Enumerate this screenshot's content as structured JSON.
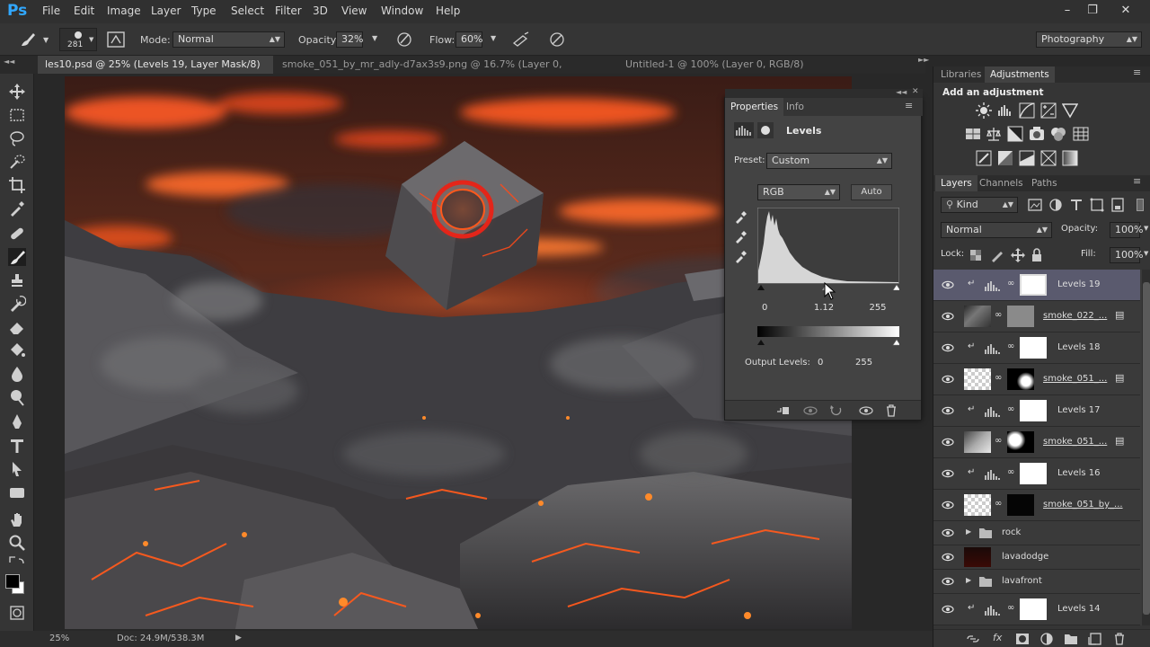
{
  "app": {
    "logo": "Ps"
  },
  "menu": [
    "File",
    "Edit",
    "Image",
    "Layer",
    "Type",
    "Select",
    "Filter",
    "3D",
    "View",
    "Window",
    "Help"
  ],
  "options": {
    "brush_size": "281",
    "mode_label": "Mode:",
    "mode_value": "Normal",
    "opacity_label": "Opacity:",
    "opacity_value": "32%",
    "flow_label": "Flow:",
    "flow_value": "60%",
    "workspace": "Photography"
  },
  "tabs": [
    {
      "label": "les10.psd @ 25% (Levels 19, Layer Mask/8) *",
      "active": true
    },
    {
      "label": "smoke_051_by_mr_adly-d7ax3s9.png @ 16.7% (Layer 0, RGB/8*)",
      "active": false
    },
    {
      "label": "Untitled-1 @ 100% (Layer 0, RGB/8) *",
      "active": false
    }
  ],
  "status": {
    "zoom": "25%",
    "doc": "Doc: 24.9M/538.3M"
  },
  "properties": {
    "tab_properties": "Properties",
    "tab_info": "Info",
    "title": "Levels",
    "preset_label": "Preset:",
    "preset_value": "Custom",
    "channel": "RGB",
    "auto_label": "Auto",
    "input_black": "0",
    "input_mid": "1.12",
    "input_white": "255",
    "output_label": "Output Levels:",
    "output_black": "0",
    "output_white": "255"
  },
  "adjustments": {
    "tab_libraries": "Libraries",
    "tab_adjustments": "Adjustments",
    "header": "Add an adjustment"
  },
  "layers_panel": {
    "tab_layers": "Layers",
    "tab_channels": "Channels",
    "tab_paths": "Paths",
    "filter_kind": "Kind",
    "blend_mode": "Normal",
    "opacity_label": "Opacity:",
    "opacity_value": "100%",
    "lock_label": "Lock:",
    "fill_label": "Fill:",
    "fill_value": "100%",
    "layers": [
      {
        "name": "Levels 19",
        "kind": "adjustment",
        "selected": true,
        "clipped": true
      },
      {
        "name": "smoke_022_...",
        "kind": "smart",
        "selected": false,
        "clipped": false
      },
      {
        "name": "Levels 18",
        "kind": "adjustment",
        "selected": false,
        "clipped": true
      },
      {
        "name": "smoke_051_...",
        "kind": "smart",
        "selected": false,
        "clipped": false
      },
      {
        "name": "Levels 17",
        "kind": "adjustment",
        "selected": false,
        "clipped": true
      },
      {
        "name": "smoke_051_...",
        "kind": "smart",
        "selected": false,
        "clipped": false
      },
      {
        "name": "Levels 16",
        "kind": "adjustment",
        "selected": false,
        "clipped": true
      },
      {
        "name": "smoke_051_by_...",
        "kind": "smart",
        "selected": false,
        "clipped": false
      },
      {
        "name": "rock",
        "kind": "group",
        "selected": false,
        "clipped": false
      },
      {
        "name": "lavadodge",
        "kind": "pixel",
        "selected": false,
        "clipped": false
      },
      {
        "name": "lavafront",
        "kind": "group",
        "selected": false,
        "clipped": false
      },
      {
        "name": "Levels 14",
        "kind": "adjustment",
        "selected": false,
        "clipped": true
      }
    ]
  }
}
